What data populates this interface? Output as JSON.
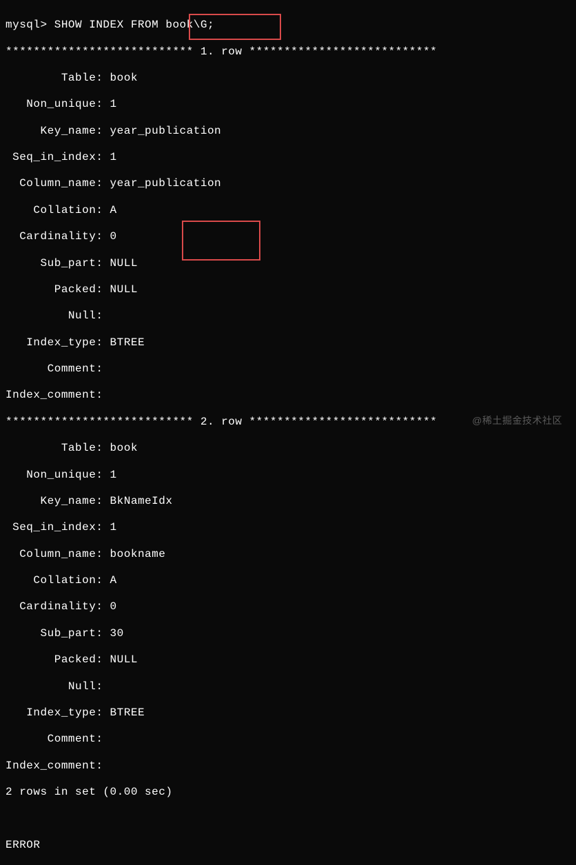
{
  "prompt": "mysql> SHOW INDEX FROM book\\G;",
  "row1_header": "*************************** 1. row ***************************",
  "row2_header": "*************************** 2. row ***************************",
  "rows": [
    {
      "Table": "book",
      "Non_unique": "1",
      "Key_name": "year_publication",
      "Seq_in_index": "1",
      "Column_name": "year_publication",
      "Collation": "A",
      "Cardinality": "0",
      "Sub_part": "NULL",
      "Packed": "NULL",
      "Null": "",
      "Index_type": "BTREE",
      "Comment": "",
      "Index_comment": ""
    },
    {
      "Table": "book",
      "Non_unique": "1",
      "Key_name": "BkNameIdx",
      "Seq_in_index": "1",
      "Column_name": "bookname",
      "Collation": "A",
      "Cardinality": "0",
      "Sub_part": "30",
      "Packed": "NULL",
      "Null": "",
      "Index_type": "BTREE",
      "Comment": "",
      "Index_comment": ""
    }
  ],
  "footer": "2 rows in set (0.00 sec)",
  "error_line": "ERROR",
  "watermark": "@稀土掘金技术社区",
  "labels": {
    "Table": "        Table: ",
    "Non_unique": "   Non_unique: ",
    "Key_name": "     Key_name: ",
    "Seq_in_index": " Seq_in_index: ",
    "Column_name": "  Column_name: ",
    "Collation": "    Collation: ",
    "Cardinality": "  Cardinality: ",
    "Sub_part": "     Sub_part: ",
    "Packed": "       Packed: ",
    "Null": "         Null: ",
    "Index_type": "   Index_type: ",
    "Comment": "      Comment: ",
    "Index_comment": "Index_comment: "
  }
}
